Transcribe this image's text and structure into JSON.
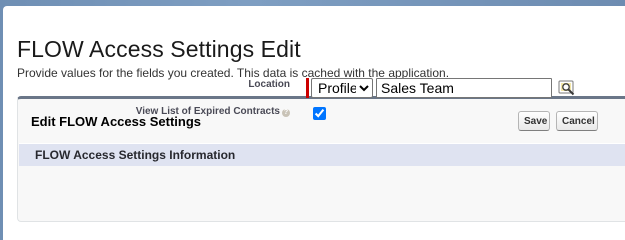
{
  "page": {
    "title": "FLOW Access Settings Edit",
    "description": "Provide values for the fields you created. This data is cached with the application."
  },
  "edit_block": {
    "title": "Edit FLOW Access Settings",
    "save_label": "Save",
    "cancel_label": "Cancel"
  },
  "section": {
    "title": "FLOW Access Settings Information"
  },
  "fields": {
    "location": {
      "label": "Location",
      "type_options": [
        "Profile"
      ],
      "type_selected": "Profile",
      "value": "Sales Team",
      "required": true
    },
    "view_expired_contracts": {
      "label": "View List of Expired Contracts",
      "checked": true
    }
  },
  "icons": {
    "help": "help-icon",
    "lookup": "lookup-icon",
    "required": "required-indicator"
  },
  "colors": {
    "accent_bar": "#6a7688",
    "section_bg": "#dfe3f1",
    "required": "#cc0000",
    "checkbox": "#0075ff"
  }
}
